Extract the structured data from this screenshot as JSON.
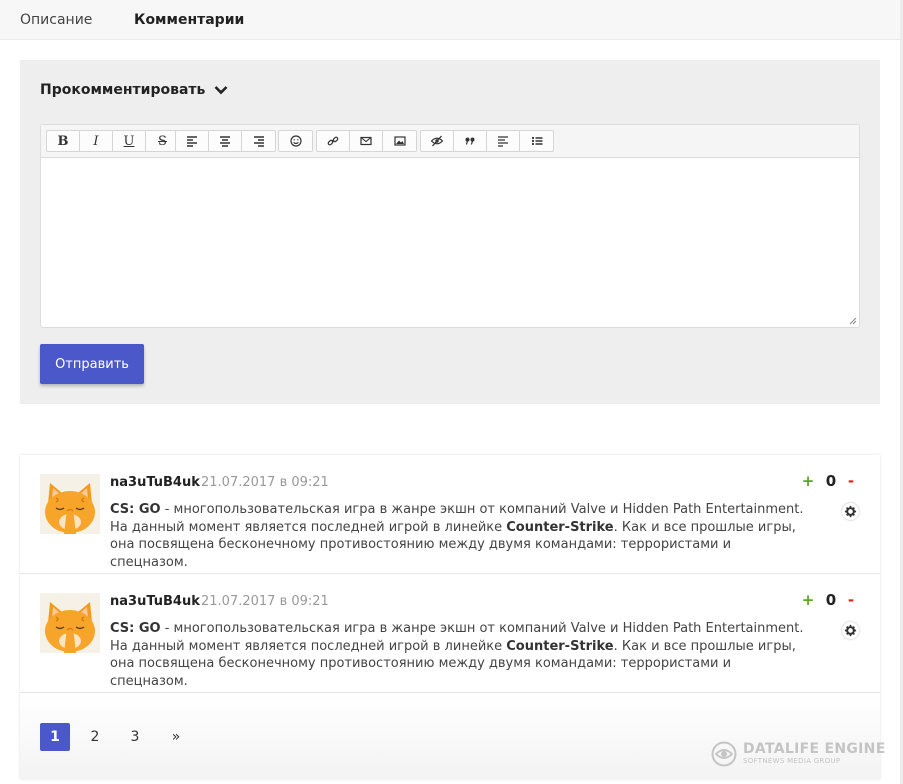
{
  "tabs": {
    "description": "Описание",
    "comments": "Комментарии"
  },
  "form": {
    "title": "Прокомментировать",
    "submit_label": "Отправить",
    "toolbar_labels": {
      "bold": "B",
      "italic": "I",
      "underline": "U",
      "strike": "S"
    }
  },
  "comments": [
    {
      "author": "na3uTuB4uk",
      "date": "21.07.2017 в 09:21",
      "text_parts": {
        "lead": "CS: GO",
        "middle": " - многопользовательская игра в жанре экшн от компаний Valve и Hidden Path Entertainment. На данный момент является последней игрой в линейке ",
        "link": "Counter-Strike",
        "end": ". Как и все прошлые игры, она посвящена бесконечному противостоянию между двумя командами: террористами и спецназом."
      },
      "rating": {
        "plus": "+",
        "value": "0",
        "minus": "-"
      }
    },
    {
      "author": "na3uTuB4uk",
      "date": "21.07.2017 в 09:21",
      "text_parts": {
        "lead": "CS: GO",
        "middle": " - многопользовательская игра в жанре экшн от компаний Valve и Hidden Path Entertainment. На данный момент является последней игрой в линейке ",
        "link": "Counter-Strike",
        "end": ". Как и все прошлые игры, она посвящена бесконечному противостоянию между двумя командами: террористами и спецназом."
      },
      "rating": {
        "plus": "+",
        "value": "0",
        "minus": "-"
      }
    }
  ],
  "pagination": {
    "pages": [
      "1",
      "2",
      "3"
    ],
    "next": "»",
    "current": "1"
  },
  "watermark": {
    "title": "DATALIFE ENGINE",
    "subtitle": "SOFTNEWS MEDIA GROUP"
  },
  "colors": {
    "accent": "#4b58c9",
    "plus": "#5aa61f",
    "minus": "#d9251d",
    "form_bg": "#eeeeee"
  },
  "icons": [
    "chevron-down-icon",
    "align-left-icon",
    "align-center-icon",
    "align-right-icon",
    "smile-icon",
    "link-icon",
    "mail-icon",
    "image-icon",
    "hide-icon",
    "quote-icon",
    "text-icon",
    "list-icon",
    "gear-icon",
    "resize-handle-icon",
    "dle-logo-icon"
  ]
}
